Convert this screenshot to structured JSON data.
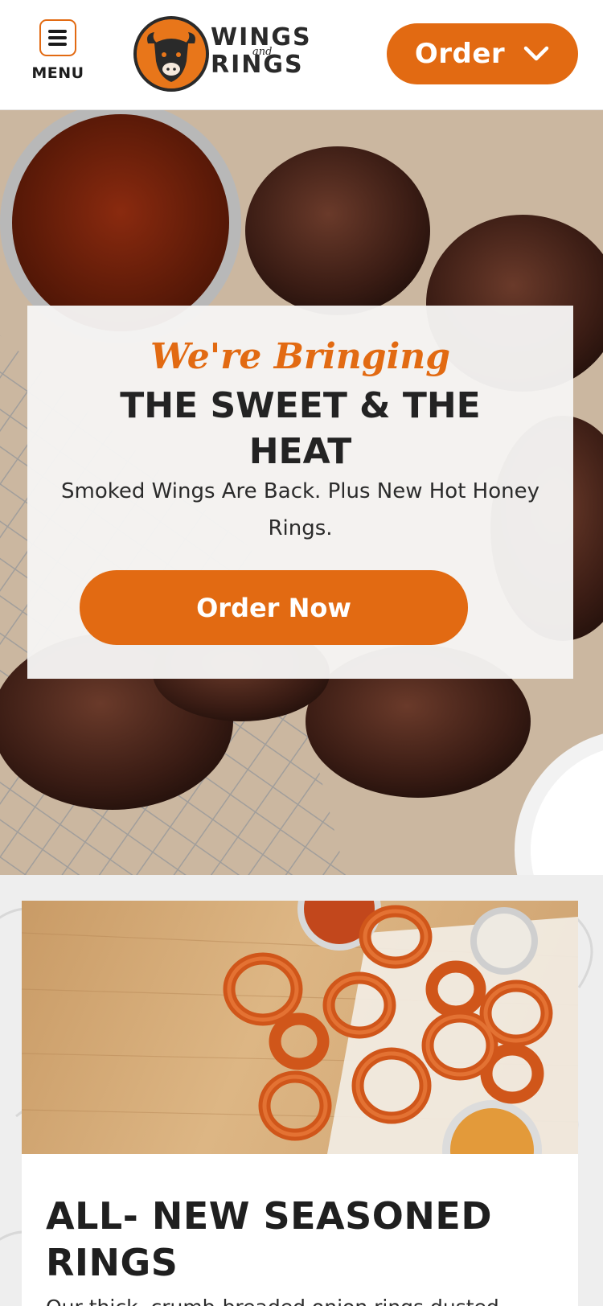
{
  "header": {
    "menu_label": "MENU",
    "logo": {
      "word_top": "WINGS",
      "word_and": "and",
      "word_bottom": "RINGS"
    },
    "order_label": "Order"
  },
  "hero": {
    "script_text": "We're Bringing",
    "title": "THE SWEET & THE HEAT",
    "subtitle": "Smoked Wings Are Back. Plus New Hot Honey Rings.",
    "cta_label": "Order Now"
  },
  "promo": {
    "title": "ALL- NEW SEASONED RINGS",
    "text": "Our thick, crumb-breaded onion rings dusted"
  },
  "colors": {
    "accent": "#e26a12",
    "text_dark": "#232323",
    "card_bg": "#f6f5f4"
  },
  "icons": {
    "menu": "hamburger-icon",
    "order_dropdown": "chevron-down-icon",
    "logo": "bison-logo-icon"
  }
}
